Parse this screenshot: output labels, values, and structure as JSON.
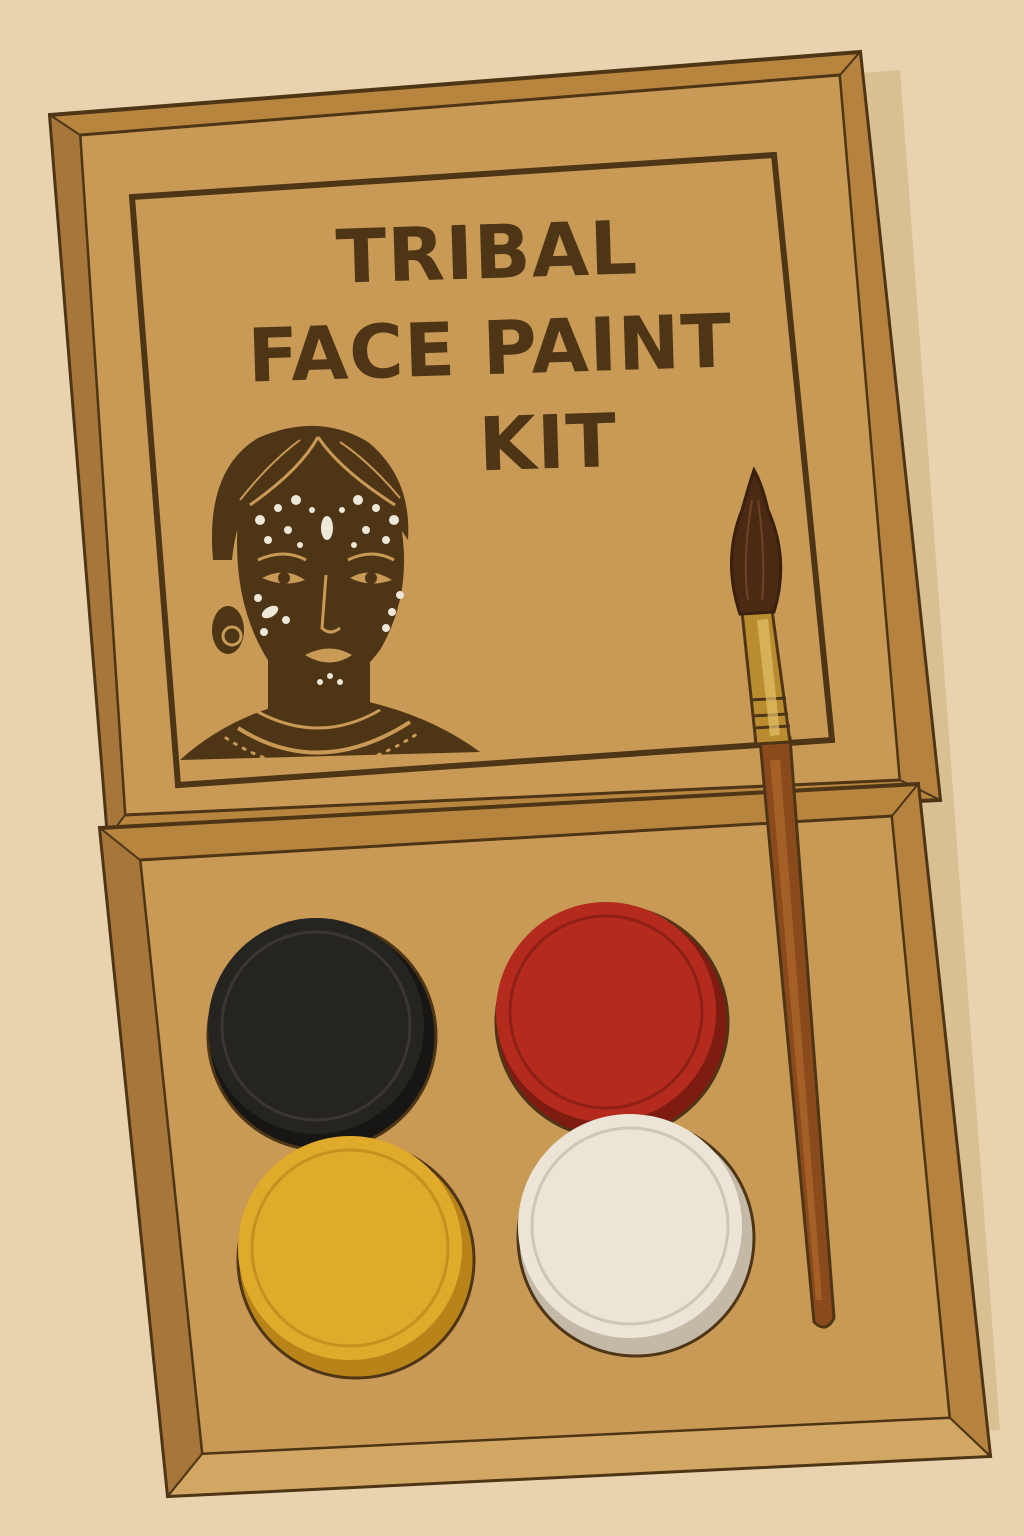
{
  "product": {
    "title_lines": [
      "TRIBAL",
      "FACE PAINT",
      "KIT"
    ]
  },
  "colors": {
    "background": "#e8d3ae",
    "cardboard": "#c99a55",
    "cardboard_dark": "#a87a3c",
    "ink": "#4e3516",
    "brush_handle": "#8a4a1c",
    "brush_ferrule": "#b98d2f"
  },
  "paints": [
    {
      "name": "black",
      "color": "#262421"
    },
    {
      "name": "red",
      "color": "#b42a1c"
    },
    {
      "name": "yellow",
      "color": "#e0aa2a"
    },
    {
      "name": "white",
      "color": "#ebe4d7"
    }
  ],
  "illustration": {
    "subject": "woman-with-dot-face-paint"
  }
}
